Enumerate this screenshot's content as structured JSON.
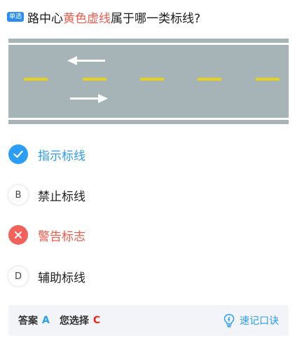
{
  "question": {
    "badge": "单选",
    "text_before": "路中心",
    "text_highlight": "黄色虚线",
    "text_after": "属于哪一类标线?"
  },
  "illustration": {
    "road_color": "#a7b4b7",
    "line_color": "#e6d21c",
    "arrow_color": "#ffffff",
    "arrows": [
      "left",
      "right"
    ]
  },
  "options": [
    {
      "letter": "A",
      "label": "指示标线",
      "state": "correct"
    },
    {
      "letter": "B",
      "label": "禁止标线",
      "state": "normal"
    },
    {
      "letter": "C",
      "label": "警告标志",
      "state": "wrong"
    },
    {
      "letter": "D",
      "label": "辅助标线",
      "state": "normal"
    }
  ],
  "answer_bar": {
    "answer_label": "答案",
    "answer_value": "A",
    "choice_label": "您选择",
    "choice_value": "C",
    "tip_label": "速记口诀"
  },
  "colors": {
    "accent": "#2a9df4",
    "error": "#f05a4b"
  }
}
